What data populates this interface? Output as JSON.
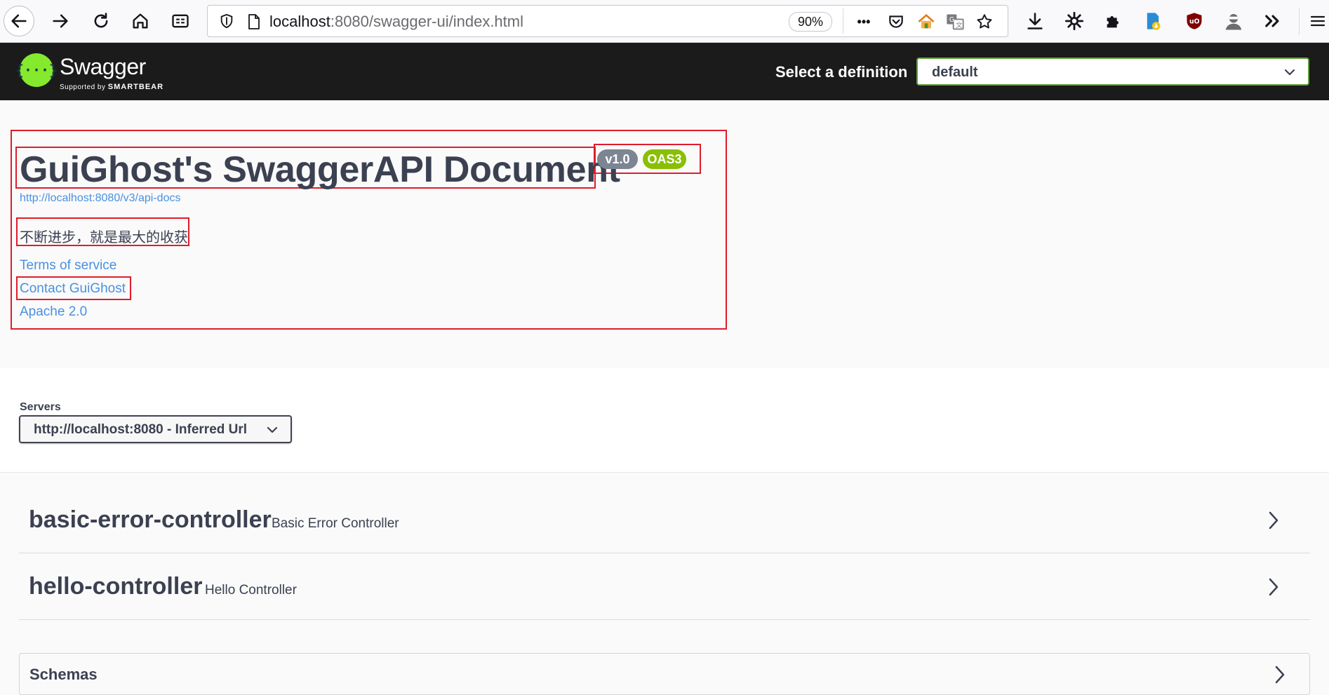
{
  "browser": {
    "url_host": "localhost",
    "url_rest": ":8080/swagger-ui/index.html",
    "zoom": "90%",
    "more_label": "•••"
  },
  "swagger": {
    "logo_glyph": "{···}",
    "logo_name": "Swagger",
    "logo_supported_by": "Supported by",
    "logo_brand": "SMARTBEAR",
    "definition_label": "Select a definition",
    "definition_value": "default"
  },
  "info": {
    "title": "GuiGhost's SwaggerAPI Document",
    "version": "v1.0",
    "oas": "OAS3",
    "docs_url": "http://localhost:8080/v3/api-docs",
    "description": "不断进步，就是最大的收获",
    "terms_label": "Terms of service",
    "contact_label": "Contact GuiGhost",
    "license_label": "Apache 2.0"
  },
  "servers": {
    "label": "Servers",
    "selected": "http://localhost:8080 - Inferred Url"
  },
  "tags": [
    {
      "name": "basic-error-controller",
      "description": "Basic Error Controller"
    },
    {
      "name": "hello-controller",
      "description": "Hello Controller"
    }
  ],
  "schemas": {
    "label": "Schemas"
  },
  "colors": {
    "swagger_green": "#85ea2d",
    "topbar_bg": "#1b1b1b",
    "link_blue": "#4990e2",
    "oas_badge": "#89bf04",
    "version_badge": "#7d8492",
    "annotation_red": "#e01c2a"
  }
}
